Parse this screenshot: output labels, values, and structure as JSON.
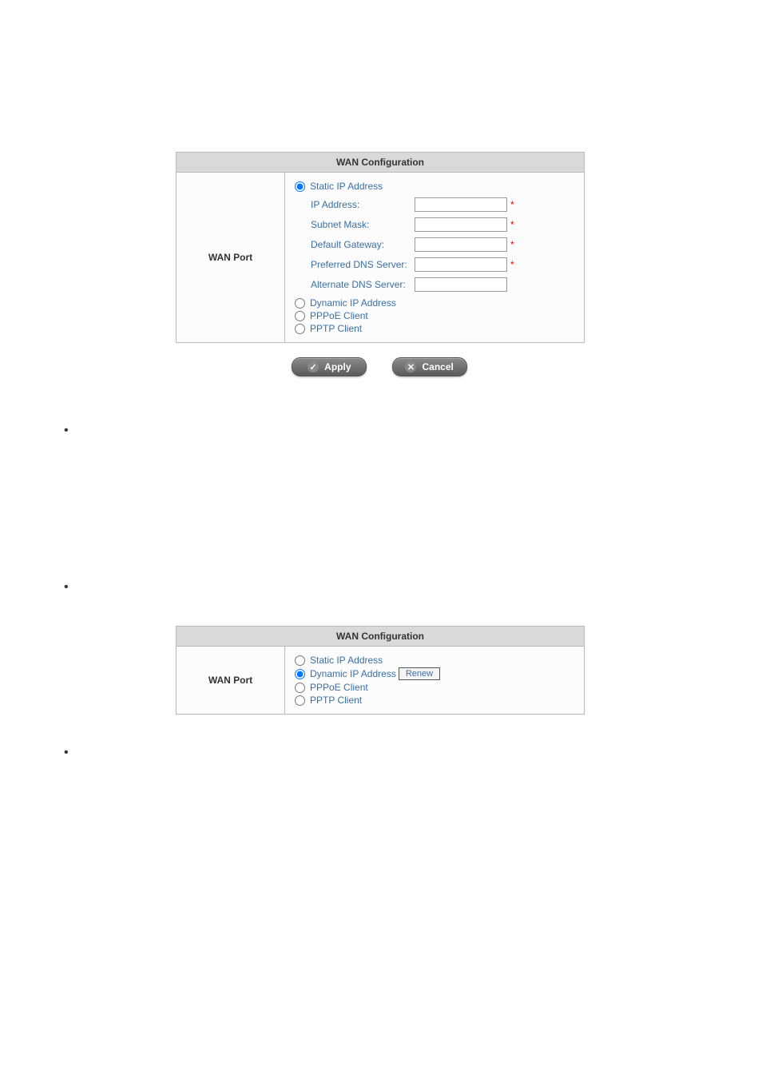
{
  "section1": {
    "title": "WAN Configuration",
    "left_label": "WAN Port",
    "options": {
      "static": "Static IP Address",
      "dynamic": "Dynamic IP Address",
      "pppoe": "PPPoE Client",
      "pptp": "PPTP Client"
    },
    "fields": {
      "ip_label": "IP Address:",
      "ip_value": "",
      "subnet_label": "Subnet Mask:",
      "subnet_value": "",
      "gateway_label": "Default Gateway:",
      "gateway_value": "",
      "dns1_label": "Preferred DNS Server:",
      "dns1_value": "",
      "dns2_label": "Alternate DNS Server:",
      "dns2_value": ""
    },
    "required_marker": "*"
  },
  "buttons": {
    "apply": "Apply",
    "cancel": "Cancel"
  },
  "section2": {
    "title": "WAN Configuration",
    "left_label": "WAN Port",
    "options": {
      "static": "Static IP Address",
      "dynamic": "Dynamic IP Address",
      "pppoe": "PPPoE Client",
      "pptp": "PPTP Client"
    },
    "renew": "Renew"
  }
}
